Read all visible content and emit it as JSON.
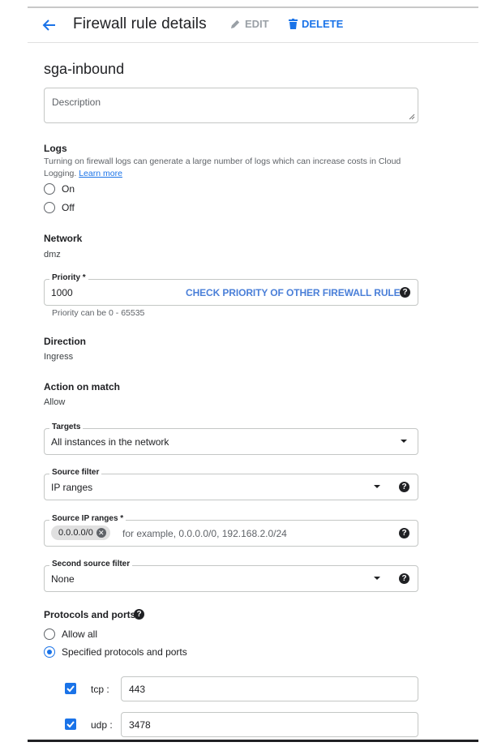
{
  "header": {
    "title": "Firewall rule details",
    "edit_label": "EDIT",
    "delete_label": "DELETE"
  },
  "rule": {
    "name": "sga-inbound"
  },
  "description": {
    "placeholder": "Description"
  },
  "logs": {
    "label": "Logs",
    "note": "Turning on firewall logs can generate a large number of logs which can increase costs in Cloud Logging.",
    "learn_more": "Learn more",
    "options": [
      {
        "label": "On",
        "selected": false
      },
      {
        "label": "Off",
        "selected": false
      }
    ]
  },
  "network": {
    "label": "Network",
    "value": "dmz"
  },
  "priority": {
    "label": "Priority *",
    "value": "1000",
    "link": "CHECK PRIORITY OF OTHER FIREWALL RULES",
    "hint": "Priority can be 0 - 65535"
  },
  "direction": {
    "label": "Direction",
    "value": "Ingress"
  },
  "action": {
    "label": "Action on match",
    "value": "Allow"
  },
  "targets": {
    "label": "Targets",
    "value": "All instances in the network"
  },
  "source_filter": {
    "label": "Source filter",
    "value": "IP ranges"
  },
  "source_ip_ranges": {
    "label": "Source IP ranges *",
    "chip": "0.0.0.0/0",
    "placeholder": "for example, 0.0.0.0/0, 192.168.2.0/24"
  },
  "second_source_filter": {
    "label": "Second source filter",
    "value": "None"
  },
  "protocols": {
    "label": "Protocols and ports",
    "options": [
      {
        "label": "Allow all",
        "selected": false
      },
      {
        "label": "Specified protocols and ports",
        "selected": true
      }
    ],
    "entries": [
      {
        "protocol": "tcp :",
        "checked": true,
        "ports": "443"
      },
      {
        "protocol": "udp :",
        "checked": true,
        "ports": "3478"
      }
    ]
  },
  "colors": {
    "accent": "#1a73e8",
    "link": "#4a7fd8",
    "disabled": "#9aa0a6"
  }
}
